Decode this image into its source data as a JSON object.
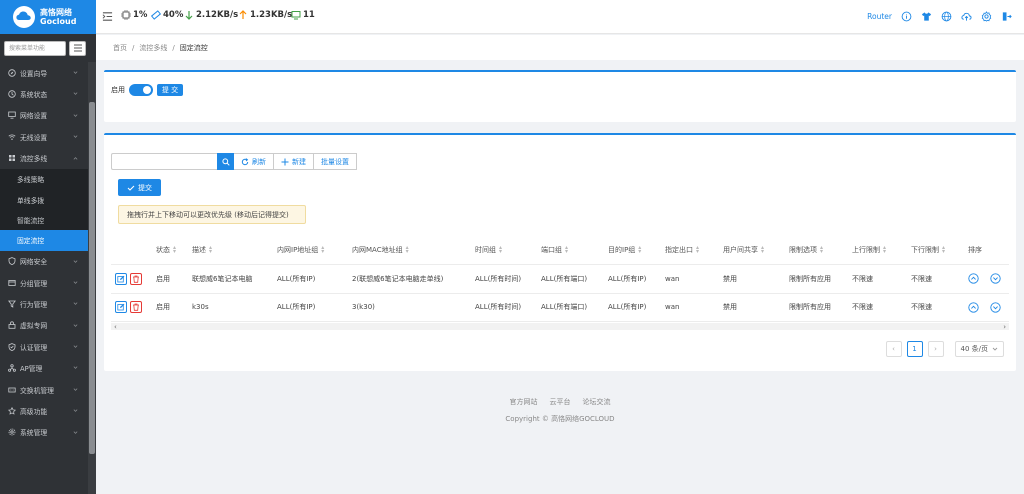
{
  "brand": {
    "name_cn": "高恪网络",
    "name_en": "Gocloud",
    "accent": "#1e88e5"
  },
  "status": {
    "cpu": "1%",
    "memory": "40%",
    "down": "2.12KB/s",
    "up": "1.23KB/s",
    "clients": "11"
  },
  "top_right": {
    "router_label": "Router",
    "icons": [
      "info-icon",
      "shirt-icon",
      "globe-icon",
      "cloud-upload-icon",
      "settings-icon",
      "logout-icon"
    ]
  },
  "sidebar": {
    "search_placeholder": "搜索菜单功能",
    "items": [
      {
        "label": "设置向导",
        "icon": "compass-icon"
      },
      {
        "label": "系统状态",
        "icon": "status-icon"
      },
      {
        "label": "网络设置",
        "icon": "monitor-icon"
      },
      {
        "label": "无线设置",
        "icon": "wifi-icon"
      },
      {
        "label": "流控多线",
        "icon": "flow-icon"
      }
    ],
    "sub_items": [
      {
        "label": "多线策略"
      },
      {
        "label": "单线多拨"
      },
      {
        "label": "智能流控"
      },
      {
        "label": "固定流控",
        "active": true
      }
    ],
    "items_after": [
      {
        "label": "网络安全",
        "icon": "shield-icon"
      },
      {
        "label": "分组管理",
        "icon": "group-icon"
      },
      {
        "label": "行为管理",
        "icon": "filter-icon"
      },
      {
        "label": "虚拟专网",
        "icon": "vpn-icon"
      },
      {
        "label": "认证管理",
        "icon": "auth-icon"
      },
      {
        "label": "AP管理",
        "icon": "ap-icon"
      },
      {
        "label": "交换机管理",
        "icon": "switch-icon"
      },
      {
        "label": "高级功能",
        "icon": "star-icon"
      },
      {
        "label": "系统管理",
        "icon": "gear-icon"
      }
    ]
  },
  "breadcrumb": [
    "首页",
    "流控多线",
    "固定流控"
  ],
  "panel1": {
    "enable_label": "启用",
    "submit_label": "提 交",
    "enabled": true
  },
  "toolbar": {
    "refresh": "刷新",
    "add": "新建",
    "batch": "批量设置",
    "confirm": "提交"
  },
  "hint": "拖拽行并上下移动可以更改优先级 (移动后记得提交)",
  "table": {
    "headers": [
      "状态",
      "描述",
      "内网IP地址组",
      "内网MAC地址组",
      "时间组",
      "端口组",
      "目的IP组",
      "指定出口",
      "用户间共享",
      "限制选项",
      "上行限制",
      "下行限制",
      "排序"
    ],
    "rows": [
      [
        "启用",
        "联想威6笔记本电脑",
        "ALL(所有IP)",
        "2(联想威6笔记本电脑走单线)",
        "ALL(所有时间)",
        "ALL(所有端口)",
        "ALL(所有IP)",
        "wan",
        "禁用",
        "限制所有应用",
        "不限速",
        "不限速"
      ],
      [
        "启用",
        "k30s",
        "ALL(所有IP)",
        "3(k30)",
        "ALL(所有时间)",
        "ALL(所有端口)",
        "ALL(所有IP)",
        "wan",
        "禁用",
        "限制所有应用",
        "不限速",
        "不限速"
      ]
    ]
  },
  "pagination": {
    "current": "1",
    "page_size": "40 条/页"
  },
  "footer": {
    "links": [
      "官方网站",
      "云平台",
      "论坛交流"
    ],
    "copyright": "Copyright © 高恪网络GOCLOUD"
  }
}
